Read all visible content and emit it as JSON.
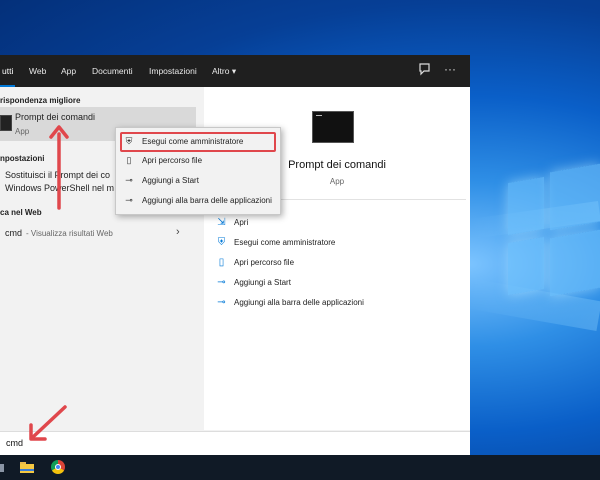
{
  "tabs": [
    {
      "label": "utti"
    },
    {
      "label": "Web"
    },
    {
      "label": "App"
    },
    {
      "label": "Documenti"
    },
    {
      "label": "Impostazioni"
    },
    {
      "label": "Altro"
    }
  ],
  "left": {
    "best_match_header": "rispondenza migliore",
    "best_match": {
      "title": "Prompt dei comandi",
      "subtitle": "App"
    },
    "settings_header": "npostazioni",
    "settings_item_line1": "Sostituisci il Prompt dei co",
    "settings_item_line2": "Windows PowerShell nel m",
    "web_header": "ca nel Web",
    "web_item": {
      "query": "cmd",
      "suffix": "- Visualizza risultati Web"
    }
  },
  "context_menu": {
    "items": [
      {
        "label": "Esegui come amministratore",
        "icon": "run-as-admin-icon",
        "highlight": true
      },
      {
        "label": "Apri percorso file",
        "icon": "folder-location-icon"
      },
      {
        "label": "Aggiungi a Start",
        "icon": "pin-icon"
      },
      {
        "label": "Aggiungi alla barra delle applicazioni",
        "icon": "pin-icon"
      }
    ]
  },
  "preview": {
    "title": "Prompt dei comandi",
    "subtitle": "App",
    "actions": [
      {
        "label": "Apri",
        "icon": "open-icon"
      },
      {
        "label": "Esegui come amministratore",
        "icon": "run-as-admin-icon"
      },
      {
        "label": "Apri percorso file",
        "icon": "folder-location-icon"
      },
      {
        "label": "Aggiungi a Start",
        "icon": "pin-icon"
      },
      {
        "label": "Aggiungi alla barra delle applicazioni",
        "icon": "pin-icon"
      }
    ]
  },
  "search": {
    "value": "cmd"
  },
  "colors": {
    "accent": "#0078d7",
    "highlight_box": "#e0474c",
    "arrow": "#e0474c"
  }
}
